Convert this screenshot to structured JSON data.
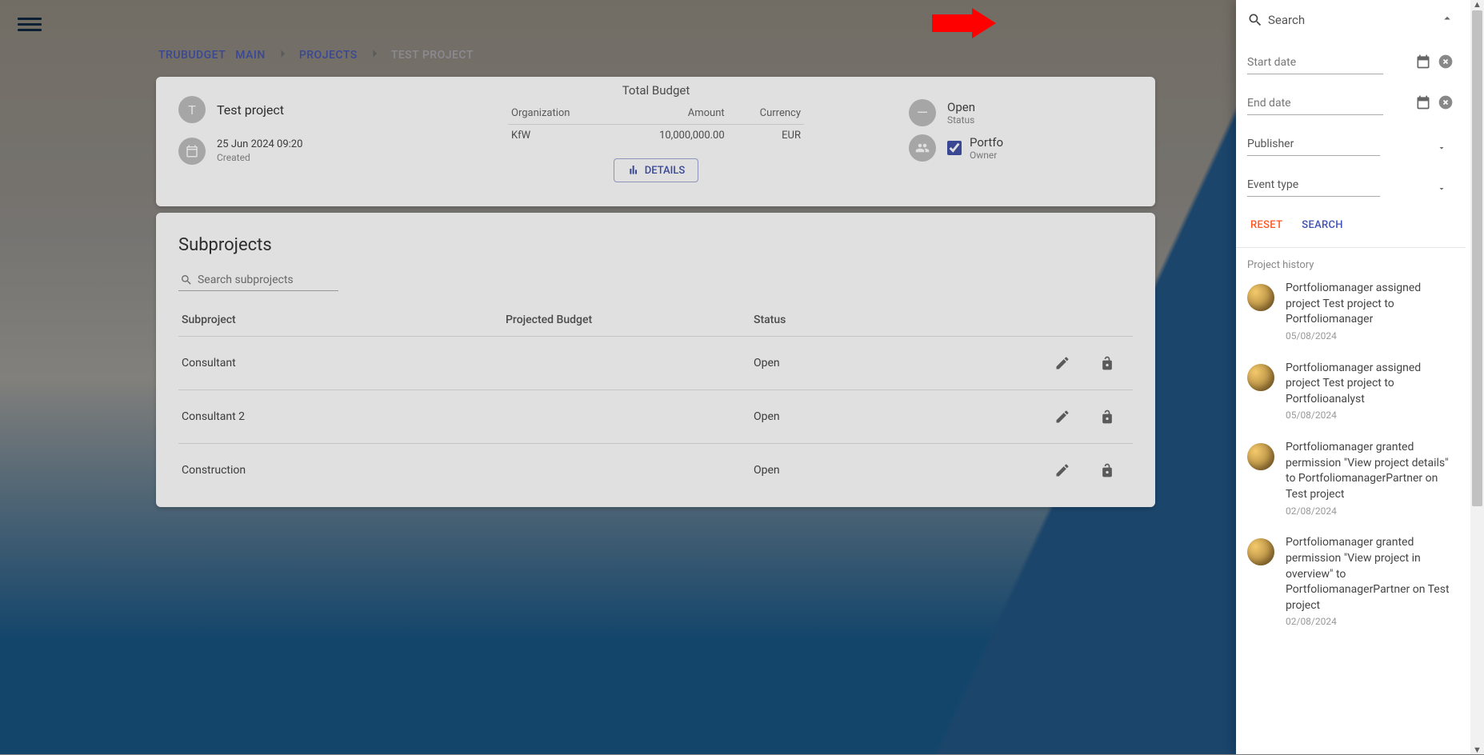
{
  "breadcrumbs": {
    "trubudget": "TRUBUDGET",
    "main": "MAIN",
    "projects": "PROJECTS",
    "current": "TEST PROJECT"
  },
  "project": {
    "avatar_letter": "T",
    "title": "Test project",
    "date": "25 Jun 2024 09:20",
    "date_label": "Created",
    "total_budget_label": "Total Budget",
    "col_org": "Organization",
    "col_amount": "Amount",
    "col_currency": "Currency",
    "budget_rows": [
      {
        "org": "KfW",
        "amount": "10,000,000.00",
        "currency": "EUR"
      }
    ],
    "details_button": "DETAILS",
    "status_value": "Open",
    "status_label": "Status",
    "owner_label": "Owner",
    "approval_value": "Portfo",
    "dash": "—"
  },
  "subprojects": {
    "heading": "Subprojects",
    "search_placeholder": "Search subprojects",
    "col_name": "Subproject",
    "col_budget": "Projected Budget",
    "col_status": "Status",
    "rows": [
      {
        "name": "Consultant",
        "budget": "",
        "status": "Open"
      },
      {
        "name": "Consultant 2",
        "budget": "",
        "status": "Open"
      },
      {
        "name": "Construction",
        "budget": "",
        "status": "Open"
      }
    ]
  },
  "drawer": {
    "search_label": "Search",
    "start_date_placeholder": "Start date",
    "end_date_placeholder": "End date",
    "publisher_label": "Publisher",
    "event_type_label": "Event type",
    "reset_btn": "RESET",
    "search_btn": "SEARCH",
    "history_heading": "Project history",
    "history": [
      {
        "text": "Portfoliomanager assigned project Test project to Portfoliomanager",
        "date": "05/08/2024"
      },
      {
        "text": "Portfoliomanager assigned project Test project to Portfolioanalyst",
        "date": "05/08/2024"
      },
      {
        "text": "Portfoliomanager granted permission \"View project details\" to PortfoliomanagerPartner on Test project",
        "date": "02/08/2024"
      },
      {
        "text": "Portfoliomanager granted permission \"View project in overview\" to PortfoliomanagerPartner on Test project",
        "date": "02/08/2024"
      }
    ]
  }
}
